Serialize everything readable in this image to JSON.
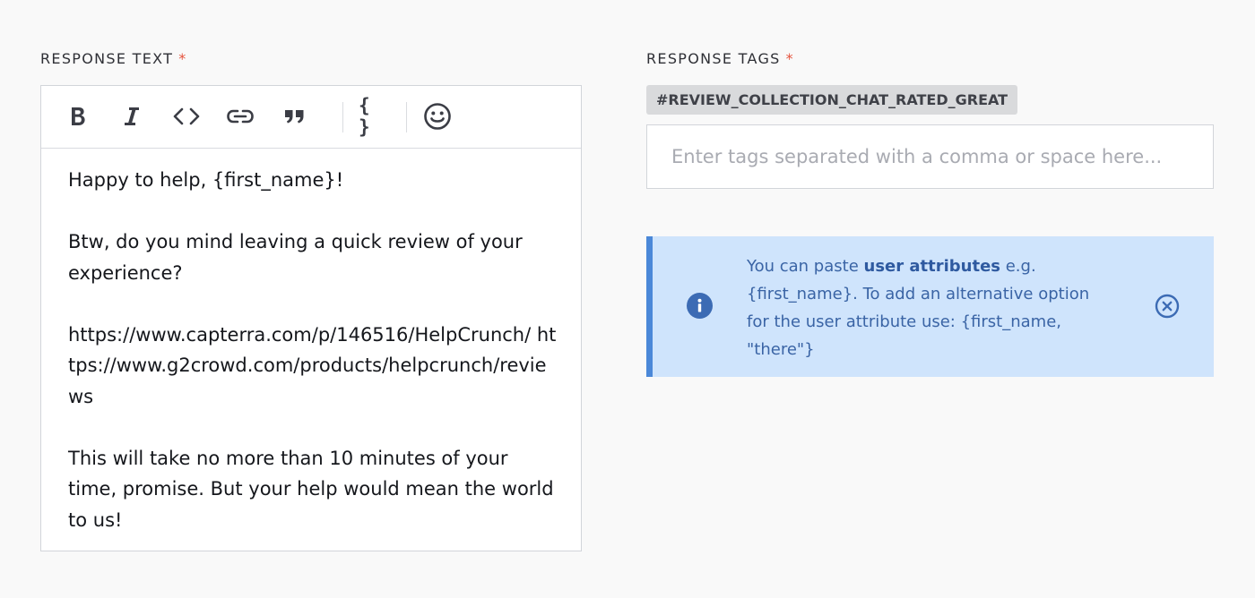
{
  "response_text": {
    "label": "RESPONSE TEXT",
    "required_marker": "*",
    "toolbar": {
      "bold_icon": "bold-icon",
      "italic_icon": "italic-icon",
      "code_icon": "code-icon",
      "link_icon": "link-icon",
      "quote_icon": "quote-icon",
      "variable_label": "{ }",
      "emoji_icon": "emoji-icon"
    },
    "paragraphs": [
      "Happy to help, {first_name}!",
      "Btw, do you mind leaving a quick review of your experience?",
      "https://www.capterra.com/p/146516/HelpCrunch/ https://www.g2crowd.com/products/helpcrunch/reviews",
      "This will take no more than 10 minutes of your time, promise. But your help would mean the world to us!"
    ]
  },
  "response_tags": {
    "label": "RESPONSE TAGS",
    "required_marker": "*",
    "tags": [
      "#REVIEW_COLLECTION_CHAT_RATED_GREAT"
    ],
    "input_placeholder": "Enter tags separated with a comma or space here...",
    "input_value": ""
  },
  "info_box": {
    "text_before": "You can paste ",
    "text_bold": "user attributes",
    "text_after": " e.g. {first_name}. To add an alternative option for the user attribute use: {first_name, \"there\"}",
    "info_icon": "info-icon",
    "close_icon": "close-circle-icon"
  },
  "colors": {
    "required": "#e5533d",
    "info_bg": "#cfe4fc",
    "info_accent": "#4b88d8",
    "info_text": "#3a64a5"
  }
}
